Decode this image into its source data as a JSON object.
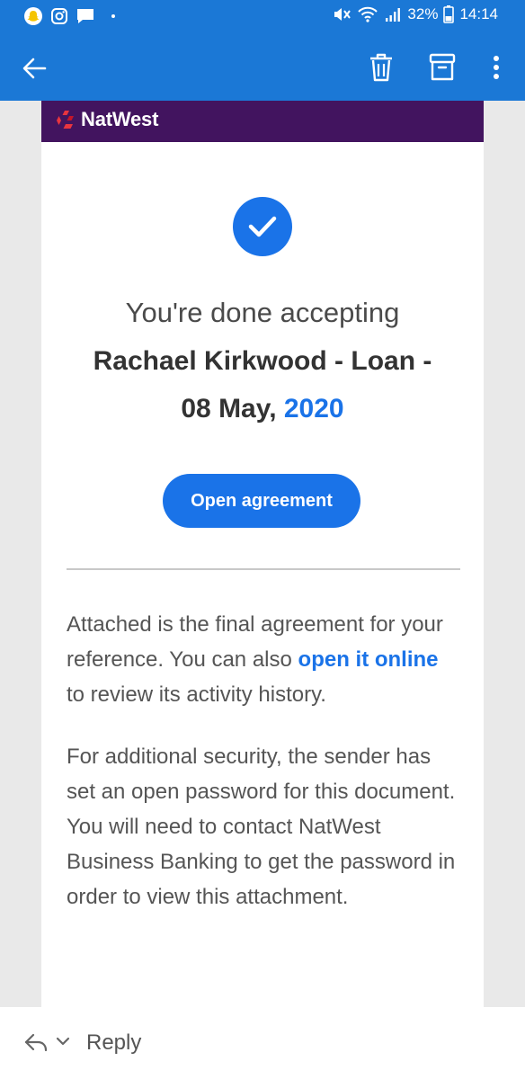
{
  "status_bar": {
    "battery": "32%",
    "time": "14:14",
    "icons": [
      "snapchat-icon",
      "instagram-icon",
      "chat-icon",
      "mute-icon",
      "wifi-icon",
      "signal-icon",
      "battery-icon"
    ]
  },
  "app_bar": {
    "icons": [
      "back-arrow-icon",
      "trash-icon",
      "archive-icon",
      "more-vert-icon"
    ]
  },
  "email": {
    "brand": "NatWest",
    "headline": "You're done accepting",
    "subject_line1": "Rachael Kirkwood - Loan -",
    "subject_line2": "08 May, ",
    "subject_year": "2020",
    "button_label": "Open agreement",
    "para1_part1": "Attached is the final agreement for your reference. You can also ",
    "para1_link": "open it online",
    "para1_part2": " to review its activity history.",
    "para2": "For additional security, the sender has set an open password for this document. You will need to contact NatWest Business Banking to get the password in order to view this attachment."
  },
  "reply_bar": {
    "label": "Reply"
  },
  "colors": {
    "app_blue": "#1b78d6",
    "brand_purple": "#42145f",
    "link_blue": "#1a73e8",
    "logo_red": "#e8353f"
  }
}
